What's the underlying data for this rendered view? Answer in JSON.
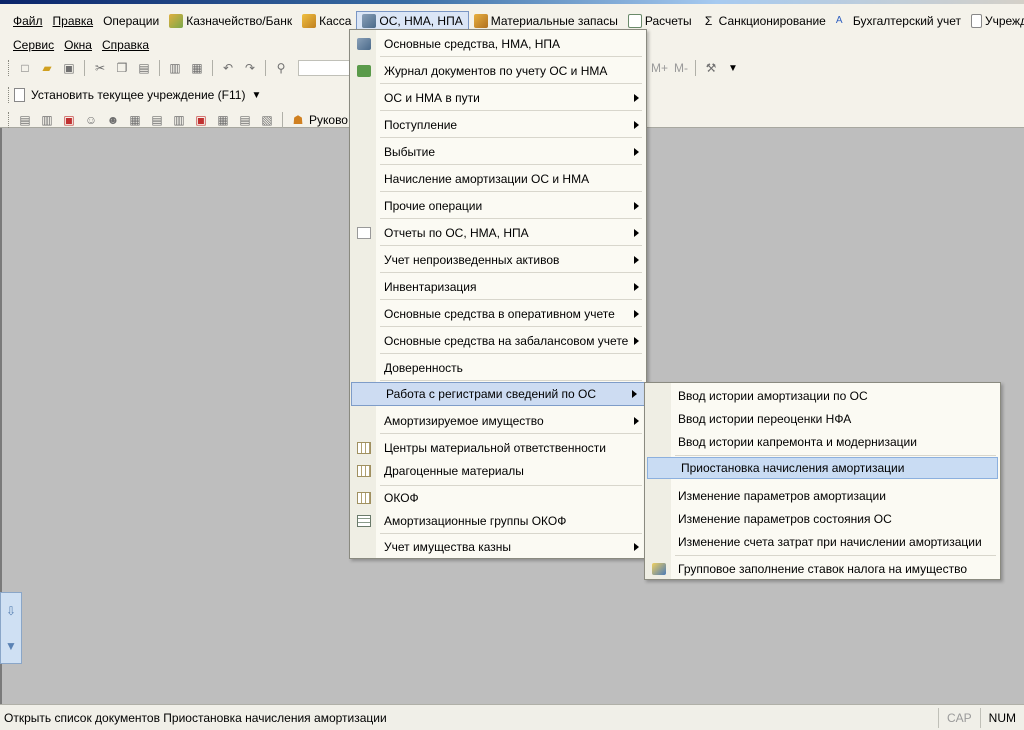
{
  "menubar": {
    "row1": [
      {
        "label": "Файл",
        "icon": null
      },
      {
        "label": "Правка",
        "icon": null
      },
      {
        "label": "Операции",
        "icon": null
      },
      {
        "label": "Казначейство/Банк",
        "icon": "bank-icon"
      },
      {
        "label": "Касса",
        "icon": "cash-icon"
      },
      {
        "label": "ОС, НМА, НПА",
        "icon": "truck-icon",
        "active": true
      },
      {
        "label": "Материальные запасы",
        "icon": "boxes-icon"
      },
      {
        "label": "Расчеты",
        "icon": "calc-icon"
      },
      {
        "label": "Санкционирование",
        "icon": "sigma-icon"
      },
      {
        "label": "Бухгалтерский учет",
        "icon": "accounting-icon"
      },
      {
        "label": "Учреждение",
        "icon": "document-icon"
      }
    ],
    "row2": [
      {
        "label": "Сервис"
      },
      {
        "label": "Окна"
      },
      {
        "label": "Справка"
      }
    ]
  },
  "toolbar": {
    "memory_buttons": [
      "M+",
      "M-"
    ],
    "set_institution_label": "Установить текущее учреждение (F11)",
    "leader_label": "Руково"
  },
  "main_menu": {
    "items": [
      {
        "label": "Основные средства, НМА, НПА",
        "icon": "truck-icon",
        "submenu": false
      },
      {
        "label": "Журнал документов по учету ОС и НМА",
        "icon": "journal-icon",
        "submenu": false
      },
      {
        "label": "ОС и НМА в пути",
        "submenu": true
      },
      {
        "label": "Поступление",
        "submenu": true
      },
      {
        "label": "Выбытие",
        "submenu": true
      },
      {
        "label": "Начисление амортизации ОС и НМА",
        "submenu": false
      },
      {
        "label": "Прочие операции",
        "submenu": true
      },
      {
        "label": "Отчеты по ОС, НМА, НПА",
        "icon": "report-icon",
        "submenu": true
      },
      {
        "label": "Учет непроизведенных активов",
        "submenu": true
      },
      {
        "label": "Инвентаризация",
        "submenu": true
      },
      {
        "label": "Основные средства в оперативном учете",
        "submenu": true
      },
      {
        "label": "Основные средства на забалансовом учете",
        "submenu": true
      },
      {
        "label": "Доверенность",
        "submenu": false
      },
      {
        "label": "Работа с регистрами сведений по ОС",
        "submenu": true,
        "highlighted": true
      },
      {
        "label": "Амортизируемое имущество",
        "submenu": true
      },
      {
        "label": "Центры материальной ответственности",
        "icon": "table-icon",
        "submenu": false
      },
      {
        "label": "Драгоценные материалы",
        "icon": "table-icon",
        "submenu": false
      },
      {
        "label": "ОКОФ",
        "icon": "table-icon",
        "submenu": false
      },
      {
        "label": "Амортизационные группы ОКОФ",
        "icon": "grid-icon",
        "submenu": false
      },
      {
        "label": "Учет имущества казны",
        "submenu": true
      }
    ]
  },
  "sub_menu": {
    "items": [
      {
        "label": "Ввод истории амортизации по ОС"
      },
      {
        "label": "Ввод истории переоценки НФА"
      },
      {
        "label": "Ввод истории капремонта и модернизации"
      },
      {
        "label": "Приостановка начисления амортизации",
        "highlighted": true
      },
      {
        "label": "Изменение параметров амортизации"
      },
      {
        "label": "Изменение параметров состояния ОС"
      },
      {
        "label": "Изменение счета затрат при начислении амортизации"
      },
      {
        "label": "Групповое заполнение ставок налога на имущество",
        "icon": "fill-icon"
      }
    ]
  },
  "statusbar": {
    "text": "Открыть список документов Приостановка начисления амортизации",
    "cap": "CAP",
    "num": "NUM"
  }
}
